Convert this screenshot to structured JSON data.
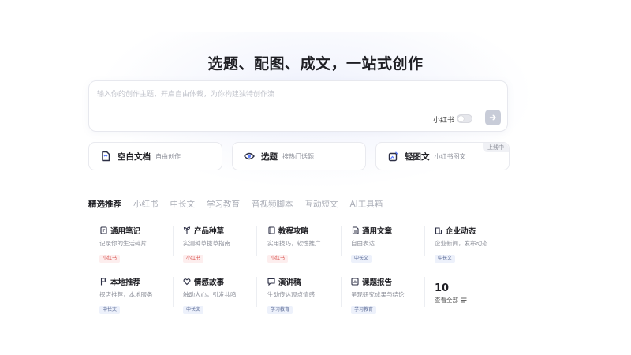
{
  "hero": {
    "title": "选题、配图、成文，一站式创作"
  },
  "composer": {
    "placeholder": "输入你的创作主题，开启自由体裁，为你构建独特创作流",
    "platform_label": "小红书",
    "toggle_on": false
  },
  "modes": [
    {
      "title": "空白文档",
      "subtitle": "自由创作",
      "icon": "document-icon"
    },
    {
      "title": "选题",
      "subtitle": "搜热门话题",
      "icon": "target-eye-icon"
    },
    {
      "title": "轻图文",
      "subtitle": "小红书图文",
      "icon": "image-edit-icon",
      "badge": "上线中"
    }
  ],
  "tabs": [
    "精选推荐",
    "小红书",
    "中长文",
    "学习教育",
    "音视频脚本",
    "互动短文",
    "AI工具箱"
  ],
  "active_tab": 0,
  "templates": [
    {
      "title": "通用笔记",
      "desc": "记录你的生活碎片",
      "tag": "小红书",
      "tag_style": "red",
      "icon": "note-icon"
    },
    {
      "title": "产品种草",
      "desc": "实测种草拔草指南",
      "tag": "小红书",
      "tag_style": "red",
      "icon": "sprout-icon"
    },
    {
      "title": "教程攻略",
      "desc": "实用技巧，软性推广",
      "tag": "小红书",
      "tag_style": "red",
      "icon": "book-icon"
    },
    {
      "title": "通用文章",
      "desc": "自由表达",
      "tag": "中长文",
      "tag_style": "blue",
      "icon": "article-icon"
    },
    {
      "title": "企业动态",
      "desc": "企业新闻，发布动态",
      "tag": "中长文",
      "tag_style": "blue",
      "icon": "building-icon"
    },
    {
      "title": "本地推荐",
      "desc": "探店推荐，本地服务",
      "tag": "中长文",
      "tag_style": "blue",
      "icon": "flag-icon"
    },
    {
      "title": "情感故事",
      "desc": "触动人心，引发共鸣",
      "tag": "中长文",
      "tag_style": "blue",
      "icon": "heart-chat-icon"
    },
    {
      "title": "演讲稿",
      "desc": "生动传达观点情感",
      "tag": "学习教育",
      "tag_style": "blue",
      "icon": "speech-icon"
    },
    {
      "title": "课题报告",
      "desc": "呈现研究成果与结论",
      "tag": "学习教育",
      "tag_style": "blue",
      "icon": "report-icon"
    }
  ],
  "more": {
    "count": "10",
    "label": "查看全部"
  }
}
